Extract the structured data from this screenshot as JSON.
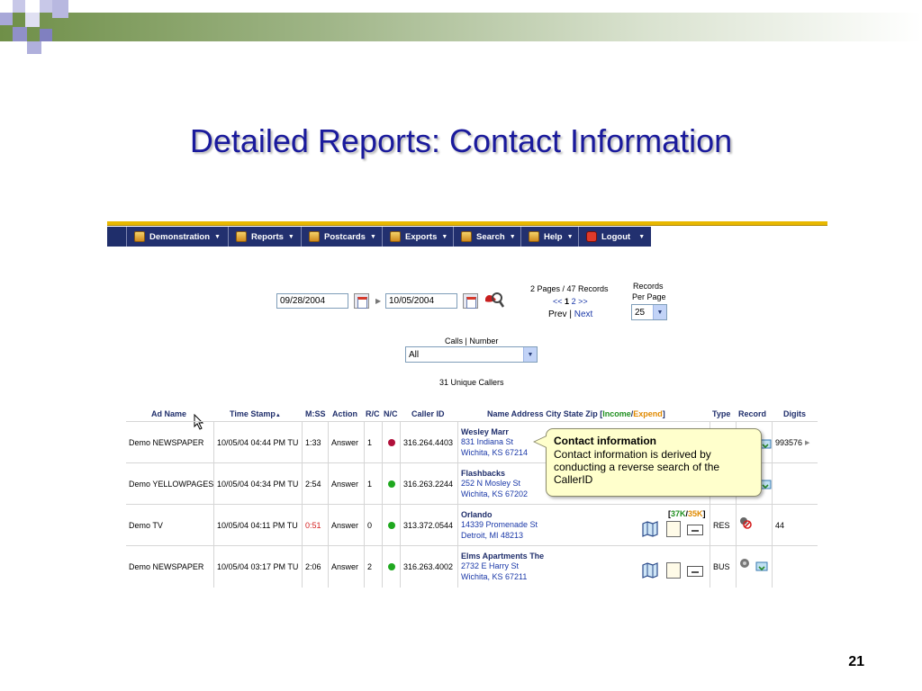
{
  "slide": {
    "title": "Detailed Reports:  Contact Information",
    "page_number": "21"
  },
  "nav": {
    "items": [
      {
        "label": "Demonstration",
        "icon": "user-icon"
      },
      {
        "label": "Reports",
        "icon": "reports-icon"
      },
      {
        "label": "Postcards",
        "icon": "postcards-icon"
      },
      {
        "label": "Exports",
        "icon": "exports-icon"
      },
      {
        "label": "Search",
        "icon": "search-icon"
      },
      {
        "label": "Help",
        "icon": "help-icon"
      },
      {
        "label": "Logout",
        "icon": "logout-icon"
      }
    ]
  },
  "filters": {
    "start_date": "09/28/2004",
    "end_date": "10/05/2004",
    "pages_label": "2 Pages / 47 Records",
    "pager_prev_arrows": "<<",
    "pager_current": "1",
    "pager_other": "2",
    "pager_next_arrows": ">>",
    "prev": "Prev",
    "pipe": "|",
    "next": "Next",
    "records_label": "Records",
    "per_page_label": "Per Page",
    "per_page_value": "25",
    "calls_label": "Calls | Number",
    "calls_value": "All",
    "unique_callers": "31 Unique Callers"
  },
  "table": {
    "headers": {
      "ad_name": "Ad Name",
      "time_stamp": "Time Stamp",
      "sort_arrow": "▲",
      "mss": "M:SS",
      "action": "Action",
      "rc": "R/C",
      "nc": "N/C",
      "caller_id": "Caller ID",
      "name_addr": "Name Address City State Zip [",
      "income": "Income",
      "slash": "/",
      "expend": "Expend",
      "close_bracket": "]",
      "type": "Type",
      "record": "Record",
      "digits": "Digits"
    },
    "rows": [
      {
        "ad": "Demo NEWSPAPER",
        "time": "10/05/04 04:44 PM TU",
        "mss": "1:33",
        "action": "Answer",
        "rc": "1",
        "dot": "#b0103a",
        "caller": "316.264.4403",
        "name": "Wesley Marr",
        "addr1": "831 Indiana St",
        "addr2": "Wichita, KS 67214",
        "type": "",
        "digits": "993576",
        "digits_arrow": "▶",
        "mss_color": "#000000"
      },
      {
        "ad": "Demo YELLOWPAGES",
        "time": "10/05/04 04:34 PM TU",
        "mss": "2:54",
        "action": "Answer",
        "rc": "1",
        "dot": "#1fa81f",
        "caller": "316.263.2244",
        "name": "Flashbacks",
        "addr1": "252 N Mosley St",
        "addr2": "Wichita, KS 67202",
        "type": "",
        "digits": "",
        "digits_arrow": "",
        "mss_color": "#000000"
      },
      {
        "ad": "Demo TV",
        "time": "10/05/04 04:11 PM TU",
        "mss": "0:51",
        "action": "Answer",
        "rc": "0",
        "dot": "#1fa81f",
        "caller": "313.372.0544",
        "name": "Orlando",
        "addr1": "14339 Promenade St",
        "addr2": "Detroit, MI 48213",
        "type": "RES",
        "digits": "44",
        "digits_arrow": "",
        "mss_color": "#d42020",
        "income_tag": "37K",
        "expend_tag": "35K",
        "tag_open": "[",
        "tag_slash": "/",
        "tag_close": "]"
      },
      {
        "ad": "Demo NEWSPAPER",
        "time": "10/05/04 03:17 PM TU",
        "mss": "2:06",
        "action": "Answer",
        "rc": "2",
        "dot": "#1fa81f",
        "caller": "316.263.4002",
        "name": "Elms Apartments The",
        "addr1": "2732 E Harry St",
        "addr2": "Wichita, KS 67211",
        "type": "BUS",
        "digits": "",
        "digits_arrow": "",
        "mss_color": "#000000"
      }
    ]
  },
  "tooltip": {
    "title": "Contact information",
    "body": "Contact information is derived by conducting a reverse search of the CallerID"
  },
  "colors": {
    "nav_bg": "#1f2e6b",
    "title_blue": "#1a1a9c",
    "income_green": "#1f8f1f",
    "expend_orange": "#e08a00"
  }
}
